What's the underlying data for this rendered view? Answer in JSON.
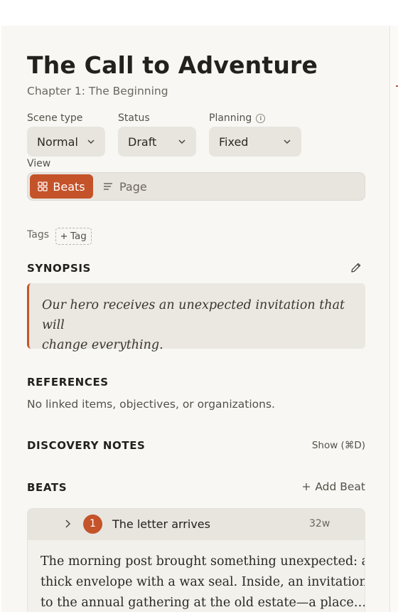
{
  "scene": {
    "title": "The Call to Adventure",
    "chapter": "Chapter 1: The Beginning"
  },
  "fields": {
    "scene_type": {
      "label": "Scene type",
      "value": "Normal"
    },
    "status": {
      "label": "Status",
      "value": "Draft"
    },
    "planning": {
      "label": "Planning",
      "value": "Fixed",
      "info_icon": "info-icon"
    }
  },
  "view": {
    "label": "View",
    "options": [
      {
        "label": "Beats",
        "icon": "grid-icon",
        "active": true
      },
      {
        "label": "Page",
        "icon": "lines-icon",
        "active": false
      }
    ]
  },
  "tags": {
    "label": "Tags",
    "add_label": "Tag"
  },
  "synopsis": {
    "heading": "SYNOPSIS",
    "lines": [
      "Our hero receives an unexpected invitation that will",
      "change everything."
    ]
  },
  "references": {
    "heading": "REFERENCES",
    "empty_text": "No linked items, objectives, or organizations."
  },
  "discovery_notes": {
    "heading": "DISCOVERY NOTES",
    "show_label": "Show (⌘D)"
  },
  "beats": {
    "heading": "BEATS",
    "add_label": "Add Beat",
    "items": [
      {
        "number": "1",
        "title": "The letter arrives",
        "word_count": "32w",
        "lines": [
          "The morning post brought something unexpected: a",
          "thick envelope with a wax seal. Inside, an invitation",
          "to the annual gathering at the old estate—a place…"
        ]
      }
    ]
  },
  "colors": {
    "accent": "#c4532a",
    "panel_bg": "#f8f7f3",
    "control_bg": "#e8e5df"
  }
}
